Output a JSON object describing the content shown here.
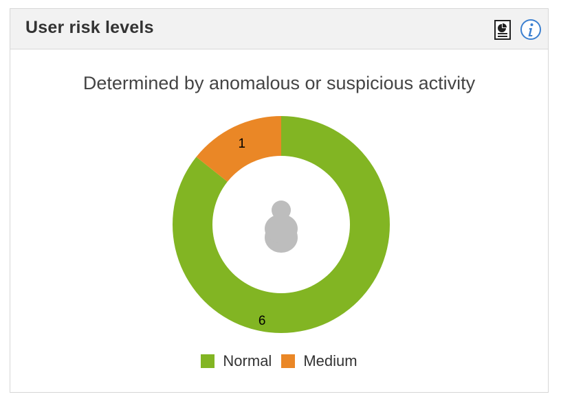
{
  "panel": {
    "title": "User risk levels",
    "report_icon": "report-icon",
    "info_icon": "info-icon"
  },
  "chart_data": {
    "type": "pie",
    "subtitle": "Determined by anomalous or suspicious activity",
    "center_icon": "user-icon",
    "series": [
      {
        "name": "Normal",
        "value": 6,
        "color": "#82b523"
      },
      {
        "name": "Medium",
        "value": 1,
        "color": "#ea8726"
      }
    ]
  }
}
